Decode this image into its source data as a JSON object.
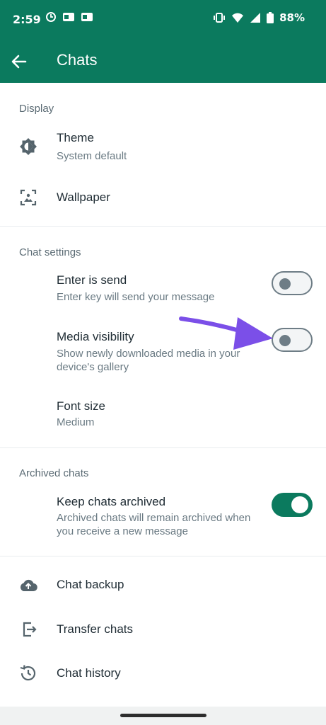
{
  "status": {
    "time": "2:59",
    "battery": "88%"
  },
  "app_bar": {
    "title": "Chats"
  },
  "sections": {
    "display": {
      "header": "Display",
      "theme": {
        "title": "Theme",
        "subtitle": "System default",
        "icon": "brightness-icon"
      },
      "wallpaper": {
        "title": "Wallpaper",
        "icon": "wallpaper-icon"
      }
    },
    "chat_settings": {
      "header": "Chat settings",
      "enter_is_send": {
        "title": "Enter is send",
        "subtitle": "Enter key will send your message",
        "enabled": false
      },
      "media_visibility": {
        "title": "Media visibility",
        "subtitle": "Show newly downloaded media in your device's gallery",
        "enabled": false
      },
      "font_size": {
        "title": "Font size",
        "subtitle": "Medium"
      }
    },
    "archived_chats": {
      "header": "Archived chats",
      "keep_archived": {
        "title": "Keep chats archived",
        "subtitle": "Archived chats will remain archived when you receive a new message",
        "enabled": true
      }
    },
    "more": {
      "chat_backup": {
        "title": "Chat backup",
        "icon": "cloud-upload-icon"
      },
      "transfer_chats": {
        "title": "Transfer chats",
        "icon": "transfer-icon"
      },
      "chat_history": {
        "title": "Chat history",
        "icon": "history-icon"
      }
    }
  },
  "colors": {
    "brand": "#0b7a5e",
    "annotation_arrow": "#7b4fe8"
  }
}
